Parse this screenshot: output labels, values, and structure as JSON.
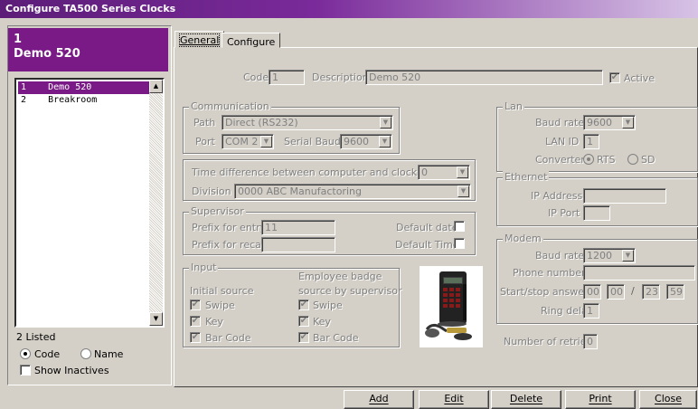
{
  "window": {
    "title": "Configure TA500 Series Clocks"
  },
  "left": {
    "header_id": "1",
    "header_name": "Demo 520",
    "clocks": [
      {
        "code": "1",
        "name": "Demo 520",
        "selected": true
      },
      {
        "code": "2",
        "name": "Breakroom",
        "selected": false
      }
    ],
    "count_label": "2 Listed",
    "sort_code_label": "Code",
    "sort_name_label": "Name",
    "sort_selected": "Code",
    "show_inactives_label": "Show Inactives"
  },
  "tabs": [
    "General",
    "Configure"
  ],
  "general": {
    "code_label": "Code",
    "code_value": "1",
    "description_label": "Description",
    "description_value": "Demo 520",
    "active_label": "Active",
    "communication": {
      "title": "Communication",
      "path_label": "Path",
      "path_value": "Direct (RS232)",
      "port_label": "Port",
      "port_value": "COM 2",
      "serial_baud_label": "Serial Baud",
      "serial_baud_value": "9600"
    },
    "time_diff_label": "Time difference between computer and clock",
    "time_diff_value": "0",
    "division_label": "Division",
    "division_value": "0000  ABC Manufactoring",
    "supervisor": {
      "title": "Supervisor",
      "prefix_entry_label": "Prefix for entry",
      "prefix_entry_value": "11",
      "prefix_recall_label": "Prefix for recall",
      "prefix_recall_value": "",
      "default_date_label": "Default date",
      "default_time_label": "Default Time"
    },
    "input": {
      "title": "Input",
      "initial_source_label": "Initial source",
      "badge_source_label_1": "Employee badge",
      "badge_source_label_2": "source by supervisor",
      "options": [
        "Swipe",
        "Key",
        "Bar Code"
      ]
    },
    "lan": {
      "title": "Lan",
      "baud_label": "Baud rate",
      "baud_value": "9600",
      "lan_id_label": "LAN ID",
      "lan_id_value": "1",
      "converter_label": "Converter",
      "converter_rts": "RTS",
      "converter_sd": "SD"
    },
    "ethernet": {
      "title": "Ethernet",
      "ip_label": "IP Address",
      "ip_value": "",
      "port_label": "IP Port",
      "port_value": ""
    },
    "modem": {
      "title": "Modem",
      "baud_label": "Baud rate",
      "baud_value": "1200",
      "phone_label": "Phone number",
      "phone_value": "",
      "startstop_label": "Start/stop answer",
      "start_h": "00",
      "start_m": "00",
      "slash": "/",
      "stop_h": "23",
      "stop_m": "59",
      "ring_label": "Ring delay",
      "ring_value": "1"
    },
    "retries_label": "Number of retries",
    "retries_value": "0"
  },
  "buttons": {
    "add": "Add",
    "edit": "Edit",
    "delete": "Delete",
    "print": "Print",
    "close": "Close"
  },
  "icons": {
    "dropdown": "chevron-down-icon",
    "check": "check-icon"
  }
}
